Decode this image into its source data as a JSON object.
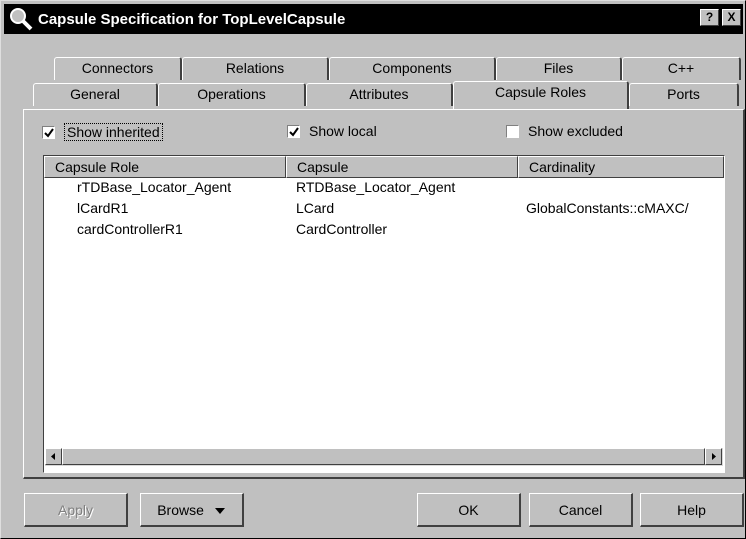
{
  "window": {
    "title": "Capsule Specification for TopLevelCapsule",
    "help_button": "?",
    "close_button": "X"
  },
  "tabs_row1": [
    {
      "label": "Connectors"
    },
    {
      "label": "Relations"
    },
    {
      "label": "Components"
    },
    {
      "label": "Files"
    },
    {
      "label": "C++"
    }
  ],
  "tabs_row2": [
    {
      "label": "General"
    },
    {
      "label": "Operations"
    },
    {
      "label": "Attributes"
    },
    {
      "label": "Capsule Roles",
      "active": true
    },
    {
      "label": "Ports"
    }
  ],
  "filters": {
    "show_inherited": {
      "label": "Show inherited",
      "checked": true
    },
    "show_local": {
      "label": "Show local",
      "checked": true
    },
    "show_excluded": {
      "label": "Show excluded",
      "checked": false
    }
  },
  "table": {
    "columns": [
      "Capsule Role",
      "Capsule",
      "Cardinality"
    ],
    "rows": [
      [
        "rTDBase_Locator_Agent",
        "RTDBase_Locator_Agent",
        ""
      ],
      [
        "lCardR1",
        "LCard",
        "GlobalConstants::cMAXC/"
      ],
      [
        "cardControllerR1",
        "CardController",
        ""
      ]
    ]
  },
  "buttons": {
    "apply": "Apply",
    "browse": "Browse",
    "ok": "OK",
    "cancel": "Cancel",
    "help": "Help"
  }
}
